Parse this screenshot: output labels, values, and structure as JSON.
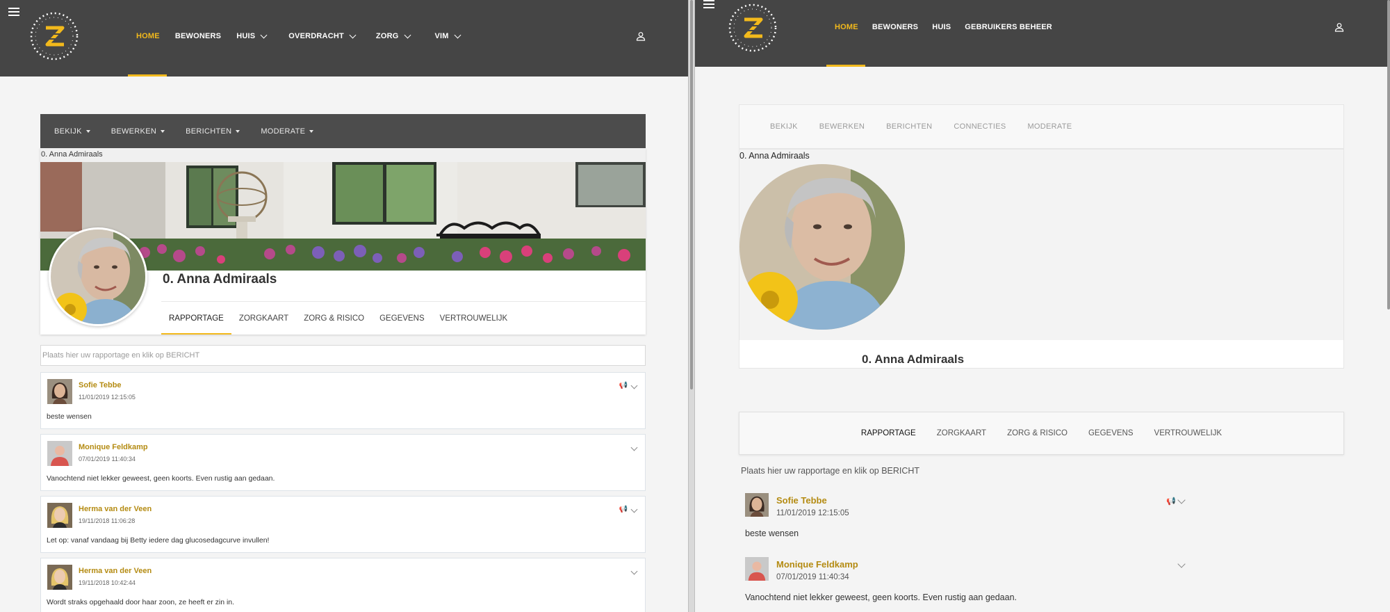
{
  "left": {
    "nav": {
      "items": [
        {
          "label": "HOME",
          "active": true,
          "dropdown": false
        },
        {
          "label": "BEWONERS",
          "active": false,
          "dropdown": false
        },
        {
          "label": "HUIS",
          "active": false,
          "dropdown": true
        },
        {
          "label": "OVERDRACHT",
          "active": false,
          "dropdown": true
        },
        {
          "label": "ZORG",
          "active": false,
          "dropdown": true
        },
        {
          "label": "VIM",
          "active": false,
          "dropdown": true
        }
      ]
    },
    "admin_menu": [
      "BEKIJK",
      "BEWERKEN",
      "BERICHTEN",
      "MODERATE"
    ],
    "breadcrumb": "0. Anna Admiraals",
    "profile_name": "0. Anna Admiraals",
    "tabs": [
      "RAPPORTAGE",
      "ZORGKAART",
      "ZORG & RISICO",
      "GEGEVENS",
      "VERTROUWELIJK"
    ],
    "post_input_placeholder": "Plaats hier uw rapportage en klik op BERICHT",
    "posts": [
      {
        "author": "Sofie Tebbe",
        "date": "11/01/2019 12:15:05",
        "text": "beste wensen",
        "flag": true,
        "avatar": "photo-f1"
      },
      {
        "author": "Monique Feldkamp",
        "date": "07/01/2019 11:40:34",
        "text": "Vanochtend niet lekker geweest, geen koorts. Even rustig aan gedaan.",
        "flag": false,
        "avatar": "placeholder"
      },
      {
        "author": "Herma van der Veen",
        "date": "19/11/2018 11:06:28",
        "text": "Let op: vanaf vandaag bij Betty iedere dag glucosedagcurve invullen!",
        "flag": true,
        "avatar": "photo-f2"
      },
      {
        "author": "Herma van der Veen",
        "date": "19/11/2018 10:42:44",
        "text": "Wordt straks opgehaald door haar zoon, ze heeft er zin in.",
        "flag": false,
        "avatar": "photo-f2"
      }
    ]
  },
  "right": {
    "nav": {
      "items": [
        {
          "label": "HOME",
          "active": true
        },
        {
          "label": "BEWONERS",
          "active": false
        },
        {
          "label": "HUIS",
          "active": false
        },
        {
          "label": "GEBRUIKERS BEHEER",
          "active": false
        }
      ]
    },
    "admin_tabs": [
      "BEKIJK",
      "BEWERKEN",
      "BERICHTEN",
      "CONNECTIES",
      "MODERATE"
    ],
    "breadcrumb": "0. Anna Admiraals",
    "profile_name": "0. Anna Admiraals",
    "tabs": [
      "RAPPORTAGE",
      "ZORGKAART",
      "ZORG & RISICO",
      "GEGEVENS",
      "VERTROUWELIJK"
    ],
    "post_input_placeholder": "Plaats hier uw rapportage en klik op BERICHT",
    "posts": [
      {
        "author": "Sofie Tebbe",
        "date": "11/01/2019 12:15:05",
        "text": "beste wensen",
        "flag": true
      },
      {
        "author": "Monique Feldkamp",
        "date": "07/01/2019 11:40:34",
        "text": "Vanochtend niet lekker geweest, geen koorts. Even rustig aan gedaan.",
        "flag": false
      }
    ]
  },
  "colors": {
    "accent": "#f2b91c",
    "navbar": "#454545",
    "author": "#b48b12",
    "flag": "#7aa7c7"
  },
  "icons": [
    "hamburger-icon",
    "logo-icon",
    "user-icon",
    "chevron-down-icon",
    "caret-down-icon",
    "megaphone-icon"
  ]
}
